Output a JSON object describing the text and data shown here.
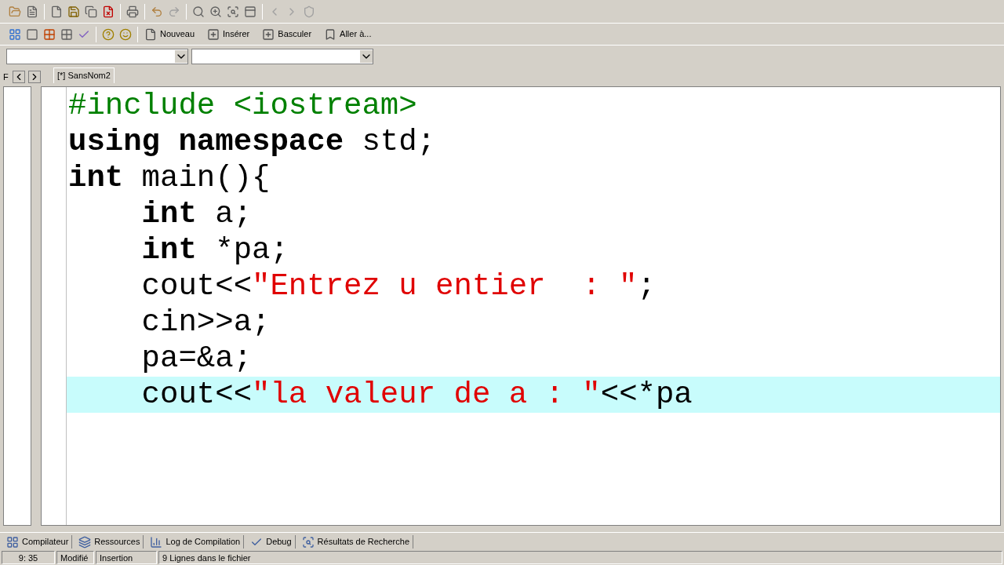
{
  "toolbar": {
    "buttons": [
      {
        "label": "Nouveau"
      },
      {
        "label": "Insérer"
      },
      {
        "label": "Basculer"
      },
      {
        "label": "Aller à..."
      }
    ]
  },
  "side_panel": {
    "tab": "F"
  },
  "editor_tabs": [
    {
      "label": "[*] SansNom2",
      "selected": true
    }
  ],
  "code_lines": [
    {
      "selected": false,
      "tokens": [
        {
          "kind": "directive",
          "text": "#include <iostream>"
        }
      ]
    },
    {
      "selected": false,
      "tokens": [
        {
          "kind": "keyword",
          "text": "using namespace"
        },
        {
          "kind": "plain",
          "text": " std;"
        }
      ]
    },
    {
      "selected": false,
      "tokens": [
        {
          "kind": "keyword",
          "text": "int"
        },
        {
          "kind": "plain",
          "text": " main(){"
        }
      ]
    },
    {
      "selected": false,
      "indented": true,
      "tokens": [
        {
          "kind": "keyword",
          "text": "int"
        },
        {
          "kind": "plain",
          "text": " a;"
        }
      ]
    },
    {
      "selected": false,
      "indented": true,
      "tokens": [
        {
          "kind": "keyword",
          "text": "int"
        },
        {
          "kind": "plain",
          "text": " *pa;"
        }
      ]
    },
    {
      "selected": false,
      "indented": true,
      "tokens": [
        {
          "kind": "plain",
          "text": "cout<<"
        },
        {
          "kind": "string",
          "text": "\"Entrez u entier  : \""
        },
        {
          "kind": "plain",
          "text": ";"
        }
      ]
    },
    {
      "selected": false,
      "indented": true,
      "tokens": [
        {
          "kind": "plain",
          "text": "cin>>a;"
        }
      ]
    },
    {
      "selected": false,
      "indented": true,
      "tokens": [
        {
          "kind": "plain",
          "text": "pa=&a;"
        }
      ]
    },
    {
      "selected": true,
      "indented": true,
      "tokens": [
        {
          "kind": "plain",
          "text": "cout<<"
        },
        {
          "kind": "string",
          "text": "\"la valeur de a : \""
        },
        {
          "kind": "plain",
          "text": "<<*pa"
        }
      ]
    }
  ],
  "bottom_tabs": [
    {
      "label": "Compilateur"
    },
    {
      "label": "Ressources"
    },
    {
      "label": "Log de Compilation"
    },
    {
      "label": "Debug"
    },
    {
      "label": "Résultats de Recherche"
    }
  ],
  "status_bar": [
    "9: 35",
    "Modifié",
    "Insertion",
    "9 Lignes dans le fichier"
  ]
}
